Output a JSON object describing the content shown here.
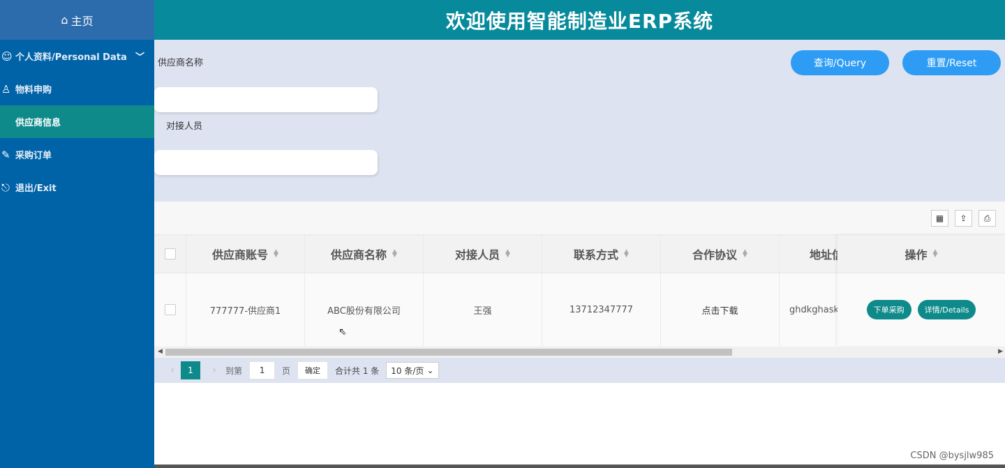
{
  "sidebar": {
    "home": {
      "icon": "home-icon",
      "label": "主页"
    },
    "items": [
      {
        "icon": "user-list-icon",
        "label": "个人资料/Personal Data"
      },
      {
        "icon": "user-icon",
        "label": "物料申购"
      },
      {
        "label": "供应商信息"
      },
      {
        "icon": "edit-icon",
        "label": "采购订单"
      },
      {
        "icon": "exit-icon",
        "label": "退出/Exit"
      }
    ],
    "colors": {
      "background": "#0063a8",
      "active": "#0e8a8a"
    }
  },
  "header": {
    "title": "欢迎使用智能制造业ERP系统",
    "color": "#078a9b"
  },
  "search": {
    "fields": [
      {
        "label": "供应商名称",
        "value": ""
      },
      {
        "label": "对接人员",
        "value": ""
      }
    ],
    "query_label": "查询/Query",
    "reset_label": "重置/Reset",
    "button_color": "#2e9cf4"
  },
  "table": {
    "toolbar": [
      {
        "icon": "columns-icon"
      },
      {
        "icon": "export-icon"
      },
      {
        "icon": "print-icon"
      }
    ],
    "columns": [
      "供应商账号",
      "供应商名称",
      "对接人员",
      "联系方式",
      "合作协议",
      "地址信"
    ],
    "action_column": "操作",
    "rows": [
      {
        "account": "777777-供应商1",
        "name": "ABC股份有限公司",
        "contact": "王强",
        "phone": "13712347777",
        "agreement": "点击下载",
        "address": "ghdkghaskd"
      }
    ],
    "actions": {
      "order": "下单采购",
      "details": "详情/Details"
    }
  },
  "pager": {
    "current": "1",
    "goto_label": "到第",
    "page_value": "1",
    "page_unit": "页",
    "confirm": "确定",
    "total": "合计共 1 条",
    "page_size": "10 条/页"
  },
  "watermark": "CSDN @bysjlw985"
}
